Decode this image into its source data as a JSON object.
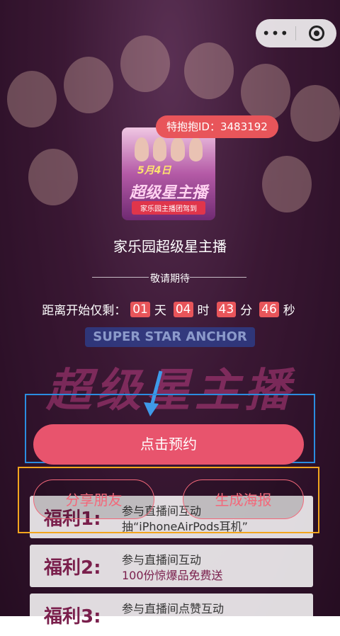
{
  "header": {
    "more_icon": "more-dots-icon",
    "close_icon": "record-circle-icon"
  },
  "poster": {
    "date": "5月4日",
    "title": "超级星主播",
    "subtitle": "家乐园主播团驾到"
  },
  "live": {
    "id_label": "特抱抱ID：3483192",
    "name": "家乐园超级星主播",
    "status": "敬请期待"
  },
  "countdown": {
    "prefix": "距离开始仅剩：",
    "days": "01",
    "days_unit": "天",
    "hours": "04",
    "hours_unit": "时",
    "minutes": "43",
    "minutes_unit": "分",
    "seconds": "46",
    "seconds_unit": "秒"
  },
  "background": {
    "stage_title": "超级星主播",
    "stage_band": "SUPER STAR ANCHOR"
  },
  "actions": {
    "reserve_label": "点击预约",
    "share_label": "分享朋友",
    "poster_label": "生成海报"
  },
  "benefits": [
    {
      "tag": "福利1:",
      "line1": "参与直播间互动",
      "line2": "抽“iPhoneAirPods耳机”"
    },
    {
      "tag": "福利2:",
      "line1": "参与直播间互动",
      "line2": "100份惊爆品免费送"
    },
    {
      "tag": "福利3:",
      "line1": "参与直播间点赞互动",
      "line2": ""
    }
  ],
  "colors": {
    "accent": "#e8546d",
    "badge": "#e8555a",
    "highlight_blue": "#2a8de0",
    "highlight_yellow": "#f2a51e"
  }
}
